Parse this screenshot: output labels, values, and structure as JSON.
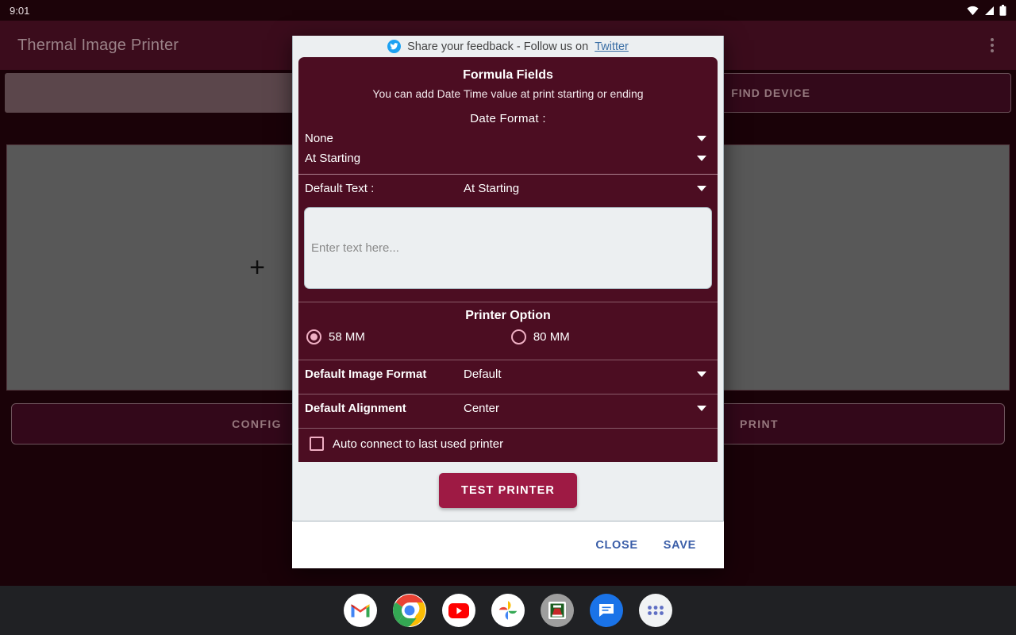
{
  "status_bar": {
    "time": "9:01",
    "icons": [
      "wifi-icon",
      "cell-signal-icon",
      "battery-icon"
    ]
  },
  "app": {
    "title": "Thermal Image Printer",
    "overflow_menu": "overflow-menu-icon",
    "device_field_value": "",
    "find_device_label": "FIND DEVICE",
    "add_image_glyph": "+",
    "config_label": "CONFIG",
    "print_label": "PRINT"
  },
  "dialog": {
    "feedback": {
      "icon": "twitter-icon",
      "text": "Share your feedback - Follow us on",
      "link": "Twitter"
    },
    "formula": {
      "title": "Formula Fields",
      "subtitle": "You can add Date Time value at print starting or ending",
      "date_format_label": "Date Format :",
      "date_format_value": "None",
      "date_position_value": "At Starting",
      "default_text_label": "Default Text :",
      "default_text_position": "At Starting",
      "textarea_value": "",
      "textarea_placeholder": "Enter text here..."
    },
    "printer_option": {
      "title": "Printer Option",
      "options": [
        {
          "label": "58 MM",
          "selected": true
        },
        {
          "label": "80 MM",
          "selected": false
        }
      ]
    },
    "settings": [
      {
        "name": "Default Image Format",
        "value": "Default"
      },
      {
        "name": "Default Alignment",
        "value": "Center"
      }
    ],
    "auto_connect": {
      "label": "Auto connect to last used printer",
      "checked": false
    },
    "test_printer_label": "TEST PRINTER",
    "close_label": "CLOSE",
    "save_label": "SAVE"
  },
  "taskbar": {
    "items": [
      {
        "name": "gmail-icon"
      },
      {
        "name": "chrome-icon"
      },
      {
        "name": "youtube-icon"
      },
      {
        "name": "google-photos-icon"
      },
      {
        "name": "printer-app-icon"
      },
      {
        "name": "messages-icon"
      },
      {
        "name": "app-drawer-icon"
      }
    ]
  },
  "colors": {
    "panel_maroon": "#4c0d22",
    "app_bar": "#3b0c1c",
    "accent_button": "#9e1a44",
    "pink_accent": "#efafc3",
    "link_blue": "#3b5ea8",
    "twitter_blue": "#1da1f2"
  }
}
